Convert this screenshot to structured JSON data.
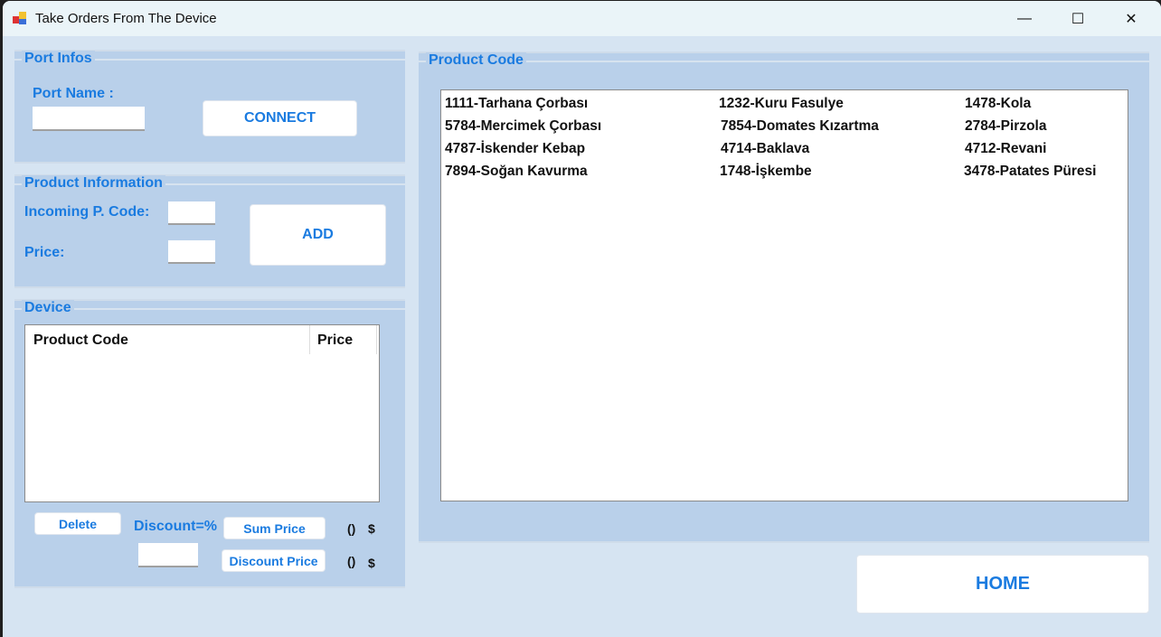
{
  "window": {
    "title": "Take Orders From The Device",
    "minimize": "—",
    "maximize": "☐",
    "close": "✕"
  },
  "port_infos": {
    "legend": "Port Infos",
    "port_name_label": "Port Name :",
    "port_name_value": "",
    "connect": "CONNECT"
  },
  "product_info": {
    "legend": "Product Information",
    "code_label": "Incoming P. Code:",
    "price_label": "Price:",
    "code_value": "",
    "price_value": "",
    "add": "ADD"
  },
  "device": {
    "legend": "Device",
    "columns": [
      "Product Code",
      "Price"
    ],
    "delete": "Delete",
    "discount_label": "Discount=%",
    "discount_value": "",
    "sum_price": "Sum Price",
    "discount_price": "Discount Price",
    "sum_value": "()",
    "sum_currency": "$",
    "discount_value_display": "()",
    "discount_currency": "$"
  },
  "product_code": {
    "legend": "Product Code",
    "items": [
      [
        "1111-Tarhana Çorbası",
        "1232-Kuru Fasulye",
        "1478-Kola"
      ],
      [
        "5784-Mercimek Çorbası",
        "7854-Domates Kızartma",
        "2784-Pirzola"
      ],
      [
        "4787-İskender Kebap",
        "4714-Baklava",
        "4712-Revani"
      ],
      [
        "7894-Soğan Kavurma",
        "1748-İşkembe",
        "3478-Patates Püresi"
      ]
    ]
  },
  "home": "HOME"
}
